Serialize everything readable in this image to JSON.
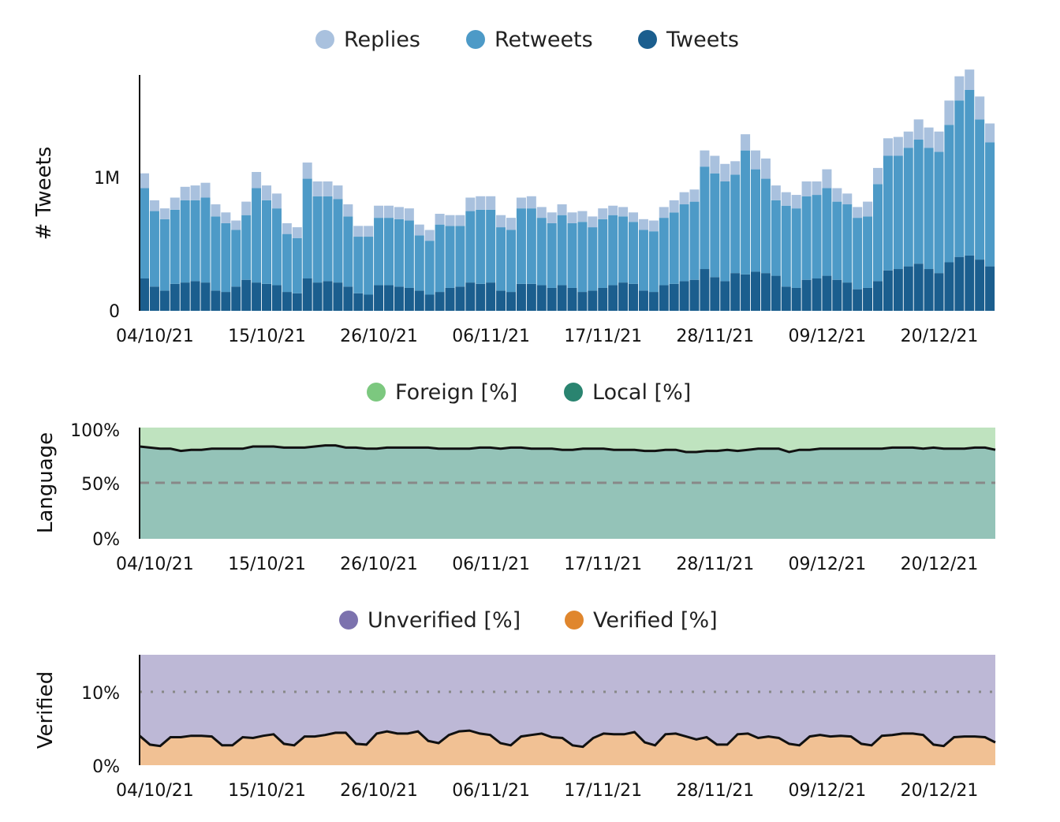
{
  "chart_data": [
    {
      "type": "bar",
      "stacked": true,
      "ylabel": "# Tweets",
      "ylim": [
        0,
        1750000
      ],
      "yticks": [
        {
          "value": 0,
          "label": "0"
        },
        {
          "value": 1000000,
          "label": "1M"
        }
      ],
      "x_tick_labels": [
        "04/10/21",
        "15/10/21",
        "26/10/21",
        "06/11/21",
        "17/11/21",
        "28/11/21",
        "09/12/21",
        "20/12/21"
      ],
      "x_tick_index": [
        1,
        12,
        23,
        34,
        45,
        56,
        67,
        78
      ],
      "legend_position": "top-center",
      "series": [
        {
          "name": "Tweets",
          "color": "#1b5e8e",
          "values": [
            240,
            180,
            150,
            200,
            210,
            220,
            210,
            150,
            140,
            180,
            230,
            210,
            200,
            190,
            140,
            130,
            240,
            210,
            220,
            210,
            180,
            130,
            120,
            190,
            190,
            180,
            170,
            150,
            120,
            140,
            170,
            180,
            210,
            200,
            210,
            150,
            140,
            200,
            200,
            190,
            170,
            190,
            170,
            140,
            150,
            170,
            190,
            210,
            200,
            150,
            140,
            190,
            200,
            220,
            230,
            310,
            250,
            220,
            280,
            270,
            290,
            280,
            260,
            180,
            170,
            230,
            240,
            260,
            230,
            210,
            160,
            170,
            220,
            300,
            310,
            330,
            350,
            310,
            280,
            360,
            400,
            410,
            380,
            330
          ]
        },
        {
          "name": "Retweets",
          "color": "#4d9ac7",
          "values": [
            670,
            560,
            530,
            550,
            610,
            600,
            630,
            550,
            510,
            420,
            480,
            700,
            620,
            570,
            430,
            410,
            740,
            640,
            630,
            620,
            520,
            420,
            430,
            500,
            500,
            500,
            500,
            410,
            400,
            500,
            460,
            450,
            530,
            550,
            540,
            470,
            460,
            560,
            560,
            500,
            480,
            520,
            480,
            520,
            470,
            510,
            520,
            490,
            460,
            450,
            450,
            500,
            530,
            570,
            580,
            760,
            770,
            740,
            730,
            920,
            760,
            700,
            560,
            600,
            590,
            620,
            620,
            650,
            580,
            580,
            530,
            530,
            720,
            850,
            840,
            880,
            920,
            900,
            900,
            1020,
            1160,
            1230,
            1040,
            920
          ]
        },
        {
          "name": "Replies",
          "color": "#a9c1de",
          "values": [
            110,
            80,
            80,
            90,
            100,
            110,
            110,
            90,
            80,
            70,
            100,
            120,
            110,
            110,
            80,
            80,
            120,
            110,
            110,
            100,
            90,
            80,
            80,
            90,
            90,
            90,
            90,
            80,
            80,
            80,
            80,
            80,
            100,
            100,
            100,
            90,
            90,
            80,
            90,
            80,
            80,
            80,
            80,
            80,
            80,
            80,
            70,
            70,
            70,
            80,
            80,
            80,
            90,
            90,
            90,
            120,
            130,
            130,
            100,
            120,
            140,
            150,
            110,
            100,
            100,
            110,
            100,
            140,
            100,
            80,
            80,
            110,
            120,
            130,
            140,
            120,
            150,
            150,
            150,
            180,
            180,
            150,
            170,
            140
          ]
        }
      ]
    },
    {
      "type": "area",
      "stacked": true,
      "ylabel": "Language",
      "ylim": [
        0,
        100
      ],
      "yticks": [
        {
          "value": 0,
          "label": "0%"
        },
        {
          "value": 50,
          "label": "50%"
        },
        {
          "value": 100,
          "label": "100%"
        }
      ],
      "reference_line": {
        "value": 50,
        "style": "dashed"
      },
      "x_tick_labels": [
        "04/10/21",
        "15/10/21",
        "26/10/21",
        "06/11/21",
        "17/11/21",
        "28/11/21",
        "09/12/21",
        "20/12/21"
      ],
      "legend_position": "top-center",
      "series": [
        {
          "name": "Foreign [%]",
          "color": "#7cc87f",
          "fill": "#bfe3bf"
        },
        {
          "name": "Local [%]",
          "color": "#2a8470",
          "fill": "#94c3b8",
          "values": [
            83,
            82,
            81,
            81,
            79,
            80,
            80,
            81,
            81,
            81,
            81,
            83,
            83,
            83,
            82,
            82,
            82,
            83,
            84,
            84,
            82,
            82,
            81,
            81,
            82,
            82,
            82,
            82,
            82,
            81,
            81,
            81,
            81,
            82,
            82,
            81,
            82,
            82,
            81,
            81,
            81,
            80,
            80,
            81,
            81,
            81,
            80,
            80,
            80,
            79,
            79,
            80,
            80,
            78,
            78,
            79,
            79,
            80,
            79,
            80,
            81,
            81,
            81,
            78,
            80,
            80,
            81,
            81,
            81,
            81,
            81,
            81,
            81,
            82,
            82,
            82,
            81,
            82,
            81,
            81,
            81,
            82,
            82,
            80
          ]
        }
      ]
    },
    {
      "type": "area",
      "stacked": true,
      "ylabel": "Verified",
      "ylim": [
        0,
        15
      ],
      "yticks": [
        {
          "value": 0,
          "label": "0%"
        },
        {
          "value": 10,
          "label": "10%"
        }
      ],
      "reference_line": {
        "value": 10,
        "style": "dotted"
      },
      "x_tick_labels": [
        "04/10/21",
        "15/10/21",
        "26/10/21",
        "06/11/21",
        "17/11/21",
        "28/11/21",
        "09/12/21",
        "20/12/21"
      ],
      "legend_position": "top-center",
      "series": [
        {
          "name": "Unverified [%]",
          "color": "#7c72ae",
          "fill": "#bdb8d6"
        },
        {
          "name": "Verified [%]",
          "color": "#e0862d",
          "fill": "#f1c194",
          "values": [
            4.0,
            2.8,
            2.6,
            3.8,
            3.8,
            4.0,
            4.0,
            3.9,
            2.7,
            2.7,
            3.8,
            3.7,
            4.0,
            4.2,
            2.9,
            2.7,
            3.9,
            3.9,
            4.1,
            4.4,
            4.4,
            2.9,
            2.8,
            4.3,
            4.6,
            4.3,
            4.3,
            4.6,
            3.3,
            3.0,
            4.1,
            4.6,
            4.7,
            4.3,
            4.1,
            3.0,
            2.7,
            3.9,
            4.1,
            4.3,
            3.8,
            3.7,
            2.7,
            2.5,
            3.7,
            4.3,
            4.2,
            4.2,
            4.5,
            3.1,
            2.7,
            4.2,
            4.3,
            3.9,
            3.5,
            3.8,
            2.8,
            2.8,
            4.2,
            4.3,
            3.7,
            3.9,
            3.7,
            2.9,
            2.7,
            3.9,
            4.1,
            3.9,
            4.0,
            3.9,
            2.9,
            2.7,
            4.0,
            4.1,
            4.3,
            4.3,
            4.1,
            2.8,
            2.6,
            3.8,
            3.9,
            3.9,
            3.8,
            3.1
          ]
        }
      ]
    }
  ]
}
